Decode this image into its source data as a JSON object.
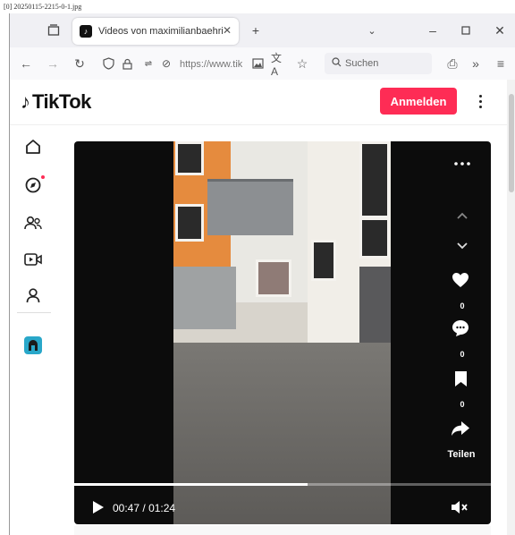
{
  "caption": "[0] 20250115-2215-0-1.jpg",
  "browser": {
    "tab_title": "Videos von maximilianbaehring",
    "url_text": "https://www.tik",
    "search_placeholder": "Suchen"
  },
  "tiktok": {
    "logo_text": "TikTok",
    "login_label": "Anmelden",
    "sidebar_items": [
      "home-icon",
      "explore-icon",
      "following-icon",
      "live-icon",
      "profile-icon",
      "avatar"
    ],
    "video": {
      "like_count": "0",
      "comment_count": "0",
      "bookmark_count": "0",
      "share_label": "Teilen",
      "current_time": "00:47",
      "duration": "01:24",
      "time_separator": "/",
      "progress_fraction": 0.56
    }
  },
  "colors": {
    "accent": "#fe2c55",
    "video_bg": "#0c0c0c"
  }
}
